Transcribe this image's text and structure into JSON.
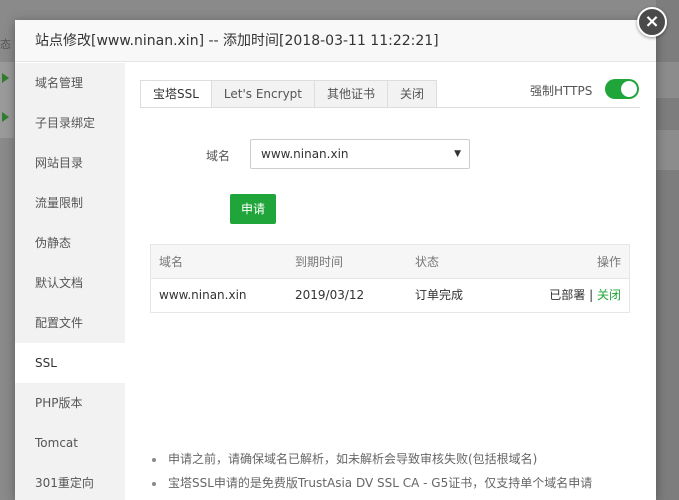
{
  "background": {
    "fragment_text": "态"
  },
  "dialog": {
    "title": "站点修改[www.ninan.xin] -- 添加时间[2018-03-11 11:22:21]",
    "close_symbol": "×"
  },
  "sidebar": {
    "items": [
      {
        "label": "域名管理"
      },
      {
        "label": "子目录绑定"
      },
      {
        "label": "网站目录"
      },
      {
        "label": "流量限制"
      },
      {
        "label": "伪静态"
      },
      {
        "label": "默认文档"
      },
      {
        "label": "配置文件"
      },
      {
        "label": "SSL"
      },
      {
        "label": "PHP版本"
      },
      {
        "label": "Tomcat"
      },
      {
        "label": "301重定向"
      }
    ],
    "active_index": 7
  },
  "tabs": [
    {
      "label": "宝塔SSL"
    },
    {
      "label": "Let's Encrypt"
    },
    {
      "label": "其他证书"
    },
    {
      "label": "关闭"
    }
  ],
  "force_https": {
    "label": "强制HTTPS",
    "enabled": true
  },
  "domain": {
    "label": "域名",
    "selected": "www.ninan.xin"
  },
  "apply_button": "申请",
  "table": {
    "headers": [
      "域名",
      "到期时间",
      "状态",
      "操作"
    ],
    "rows": [
      {
        "domain": "www.ninan.xin",
        "expiry": "2019/03/12",
        "status": "订单完成",
        "deployed": "已部署",
        "separator": "|",
        "close": "关闭"
      }
    ]
  },
  "notes": [
    "申请之前，请确保域名已解析，如未解析会导致审核失败(包括根域名)",
    "宝塔SSL申请的是免费版TrustAsia DV SSL CA - G5证书，仅支持单个域名申请"
  ],
  "colors": {
    "accent_green": "#20a53a"
  }
}
